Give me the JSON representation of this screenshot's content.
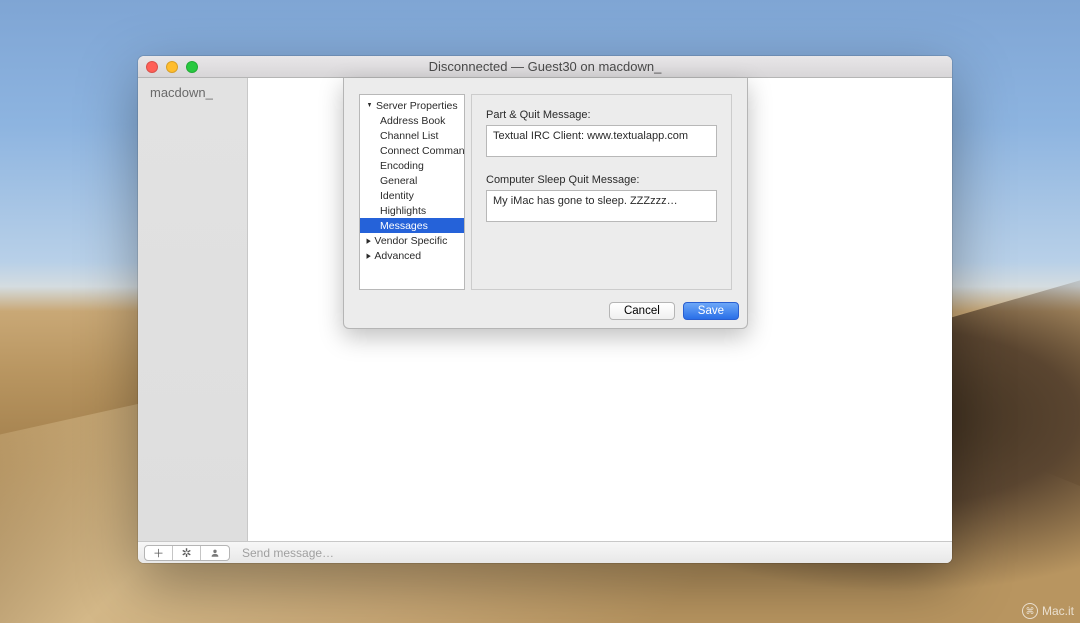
{
  "window": {
    "title": "Disconnected — Guest30 on macdown_"
  },
  "sidebar": {
    "items": [
      {
        "label": "macdown_"
      }
    ]
  },
  "bottombar": {
    "message_placeholder": "Send message…"
  },
  "dialog": {
    "tree": {
      "root": "Server Properties",
      "children": [
        "Address Book",
        "Channel List",
        "Connect Commands",
        "Encoding",
        "General",
        "Identity",
        "Highlights",
        "Messages"
      ],
      "vendor": "Vendor Specific",
      "advanced": "Advanced",
      "selected": "Messages"
    },
    "form": {
      "part_label": "Part & Quit Message:",
      "part_value": "Textual IRC Client: www.textualapp.com",
      "sleep_label": "Computer Sleep Quit Message:",
      "sleep_value": "My iMac has gone to sleep. ZZZzzz…"
    },
    "buttons": {
      "cancel": "Cancel",
      "save": "Save"
    }
  },
  "watermark": {
    "text": "Mac.it"
  }
}
